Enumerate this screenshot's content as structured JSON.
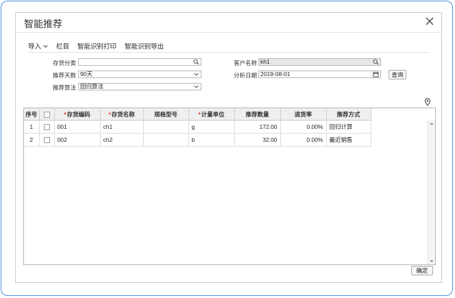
{
  "dialog": {
    "title": "智能推荐"
  },
  "toolbar": {
    "import": "导入",
    "columns": "栏目",
    "print": "智能识别打印",
    "export": "智能识别导出"
  },
  "filters": {
    "category_label": "存货分类",
    "category_value": "",
    "days_label": "推荐天数",
    "days_value": "90天",
    "algo_label": "推荐算法",
    "algo_value": "回归算法",
    "customer_label": "客户名称",
    "customer_value": "kh1",
    "date_label": "分析日期",
    "date_value": "2019-08-01",
    "query_button": "查询"
  },
  "table": {
    "headers": [
      "序号",
      "",
      "存货编码",
      "存货名称",
      "规格型号",
      "计量单位",
      "推荐数量",
      "退货率",
      "推荐方式"
    ],
    "rows": [
      [
        "1",
        "",
        "001",
        "ch1",
        "",
        "g",
        "172.00",
        "0.00%",
        "回归计算"
      ],
      [
        "2",
        "",
        "002",
        "ch2",
        "",
        "b",
        "32.00",
        "0.00%",
        "最近销售"
      ]
    ]
  },
  "footer": {
    "ok_button": "确定"
  },
  "colors": {
    "frame_border": "#4a8fe0",
    "required_mark": "#e0262a",
    "header_bg": "#efefef"
  }
}
